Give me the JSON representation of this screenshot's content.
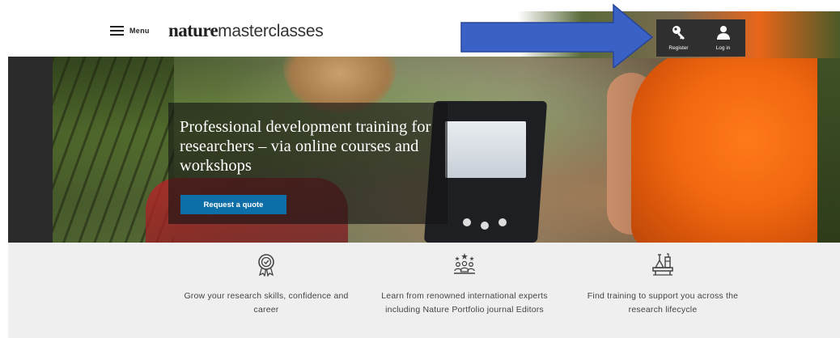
{
  "header": {
    "menu_label": "Menu",
    "logo_bold": "nature",
    "logo_light": "masterclasses",
    "account": {
      "register_label": "Register",
      "login_label": "Log in"
    }
  },
  "hero": {
    "title": "Professional development training for researchers – via online courses and workshops",
    "cta_label": "Request a quote"
  },
  "features": [
    {
      "icon": "award-rosette-icon",
      "text": "Grow your research skills, confidence and career"
    },
    {
      "icon": "people-stars-icon",
      "text": "Learn from renowned international experts including Nature Portfolio journal Editors"
    },
    {
      "icon": "lab-bench-icon",
      "text": "Find training to support you across the research lifecycle"
    }
  ],
  "colors": {
    "cta_blue": "#0e6fa8",
    "arrow_blue": "#3a62c6",
    "account_bg": "#2f2f2f",
    "features_bg": "#efefef"
  }
}
